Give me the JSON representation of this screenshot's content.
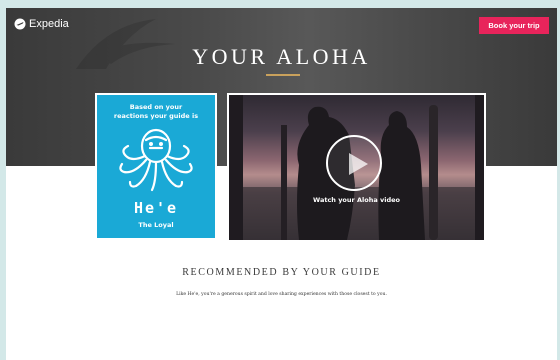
{
  "header": {
    "logo_text": "Expedia",
    "book_button": "Book your trip"
  },
  "hero": {
    "title": "YOUR ALOHA"
  },
  "guide_card": {
    "based_on_line1": "Based on your",
    "based_on_line2": "reactions your guide is",
    "name": "He'e",
    "trait": "The Loyal",
    "icon": "octopus-icon"
  },
  "video": {
    "label": "Watch your Aloha video",
    "icon": "play-icon"
  },
  "recommended": {
    "heading": "RECOMMENDED BY YOUR GUIDE",
    "text": "Like He'e, you're a generous spirit and love sharing experiences with those closest to you."
  },
  "colors": {
    "accent": "#e8245b",
    "guide_card": "#1aa9d6",
    "gold": "#c9a15c",
    "backdrop": "#d3e8e8"
  }
}
